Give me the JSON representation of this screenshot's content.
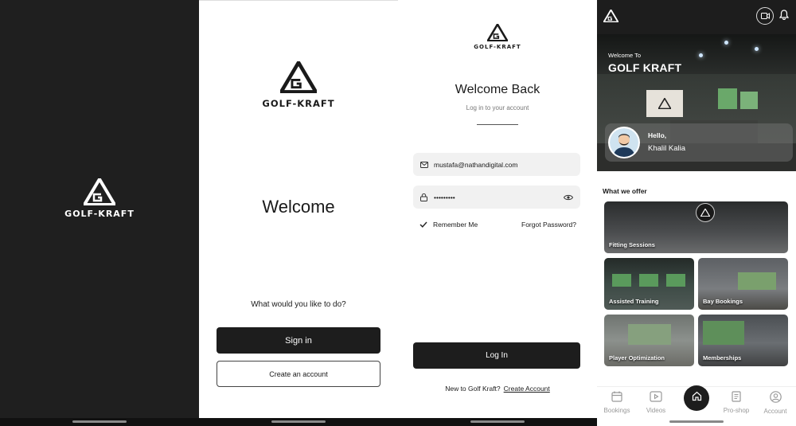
{
  "brand": {
    "name": "GOLF-KRAFT"
  },
  "splash": {
    "logo_text": "GOLF-KRAFT"
  },
  "welcome_screen": {
    "logo_text": "GOLF-KRAFT",
    "title": "Welcome",
    "question": "What would you like to do?",
    "sign_in_label": "Sign in",
    "create_account_label": "Create an account"
  },
  "login_screen": {
    "logo_text": "GOLF-KRAFT",
    "title": "Welcome Back",
    "subtitle": "Log in to your account",
    "email_value": "mustafa@nathandigital.com",
    "password_value": "•••••••••",
    "remember_me_label": "Remember Me",
    "forgot_password_label": "Forgot Password?",
    "login_label": "Log In",
    "new_prompt": "New to Golf Kraft?",
    "create_account_link": "Create Account"
  },
  "home_screen": {
    "welcome_to": "Welcome To",
    "hero_title": "GOLF KRAFT",
    "greeting": "Hello,",
    "user_name": "Khalil Kalia",
    "section_title": "What we offer",
    "tiles": [
      {
        "label": "Fitting Sessions"
      },
      {
        "label": "Assisted Training"
      },
      {
        "label": "Bay Bookings"
      },
      {
        "label": "Player Optimization"
      },
      {
        "label": "Memberships"
      }
    ],
    "nav": [
      {
        "label": "Bookings",
        "icon": "calendar-icon"
      },
      {
        "label": "Videos",
        "icon": "play-icon"
      },
      {
        "label": "",
        "icon": "home-icon"
      },
      {
        "label": "Pro-shop",
        "icon": "book-icon"
      },
      {
        "label": "Account",
        "icon": "user-icon"
      }
    ]
  },
  "colors": {
    "dark": "#1d1d1d",
    "background": "#ffffff",
    "muted": "#999999"
  }
}
